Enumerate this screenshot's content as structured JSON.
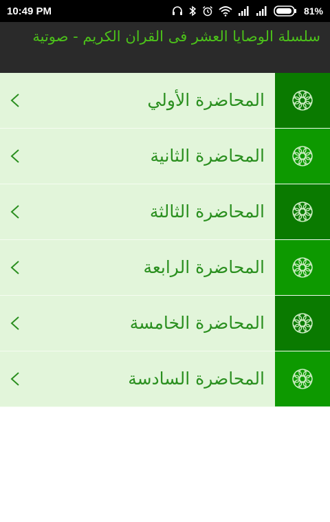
{
  "status_bar": {
    "time": "10:49 PM",
    "battery": "81%",
    "icons": [
      "headphones-icon",
      "bluetooth-icon",
      "alarm-icon",
      "wifi-icon",
      "signal-icon",
      "signal-icon",
      "battery-icon"
    ]
  },
  "app_bar": {
    "title": "سلسلة الوصايا العشر فى القران الكريم - صوتية"
  },
  "lectures": [
    {
      "label": "المحاضرة الأولي"
    },
    {
      "label": "المحاضرة الثانية"
    },
    {
      "label": "المحاضرة الثالثة"
    },
    {
      "label": "المحاضرة الرابعة"
    },
    {
      "label": "المحاضرة الخامسة"
    },
    {
      "label": "المحاضرة السادسة"
    }
  ],
  "colors": {
    "accent_green": "#4cc21a",
    "row_background": "#e2f5da",
    "icon_cell_dark": "#0a7a00",
    "icon_cell_bright": "#0d9900",
    "label_green": "#2a8f1f"
  }
}
